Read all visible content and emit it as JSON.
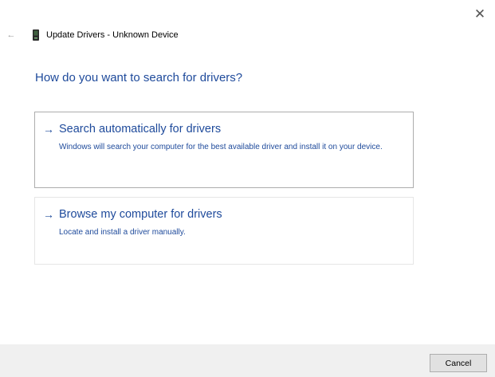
{
  "window": {
    "title": "Update Drivers - Unknown Device",
    "close_glyph": "✕",
    "back_glyph": "←"
  },
  "main": {
    "heading": "How do you want to search for drivers?",
    "options": [
      {
        "arrow": "→",
        "title": "Search automatically for drivers",
        "description": "Windows will search your computer for the best available driver and install it on your device."
      },
      {
        "arrow": "→",
        "title": "Browse my computer for drivers",
        "description": "Locate and install a driver manually."
      }
    ]
  },
  "footer": {
    "cancel_label": "Cancel"
  },
  "colors": {
    "accent": "#1e4a9b",
    "footer_bg": "#f0f0f0"
  },
  "icons": {
    "close": "close-icon",
    "back": "back-arrow-icon",
    "device": "device-icon",
    "option_arrow": "arrow-right-icon"
  }
}
